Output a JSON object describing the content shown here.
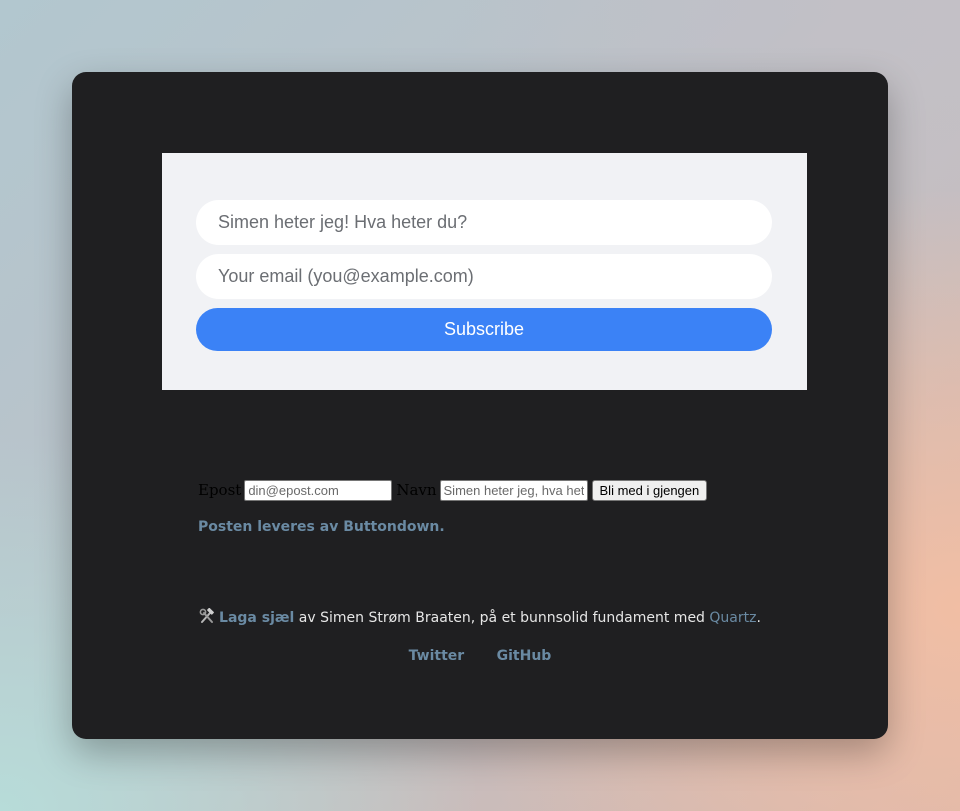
{
  "subscribe_embed": {
    "name_placeholder": "Simen heter jeg! Hva heter du?",
    "email_placeholder": "Your email (you@example.com)",
    "button_label": "Subscribe",
    "button_color": "#3b82f6",
    "panel_color": "#f1f2f5"
  },
  "native_form": {
    "email_label": "Epost",
    "email_placeholder": "din@epost.com",
    "name_label": "Navn",
    "name_placeholder": "Simen heter jeg, hva heter du?",
    "submit_label": "Bli med i gjengen"
  },
  "powered_by": "Posten leveres av Buttondown.",
  "footer": {
    "icon": "hammer-and-wrench-icon",
    "made_link": "Laga sjæl",
    "made_text": " av Simen Strøm Braaten, på et bunnsolid fundament med ",
    "quartz_link": "Quartz",
    "period": ".",
    "links": [
      "Twitter",
      "GitHub"
    ]
  },
  "colors": {
    "window_background": "#1f1f21",
    "link": "#6a8aa3"
  }
}
